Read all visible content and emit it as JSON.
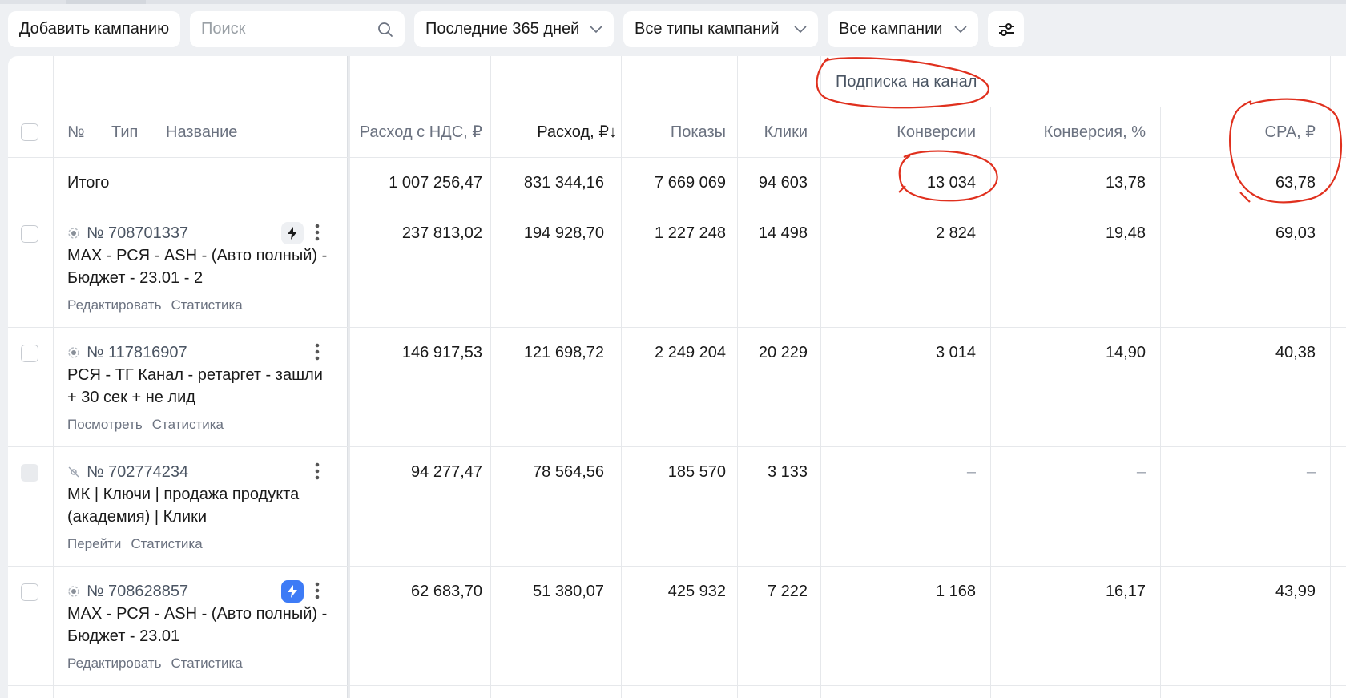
{
  "toolbar": {
    "add_campaign": "Добавить кампанию",
    "search_placeholder": "Поиск",
    "period": "Последние 365 дней",
    "campaign_types": "Все типы кампаний",
    "campaigns": "Все кампании"
  },
  "table": {
    "group_header": "Подписка на канал",
    "headers": {
      "number": "№",
      "type": "Тип",
      "name": "Название",
      "spend_vat": "Расход с НДС, ₽",
      "spend": "Расход, ₽↓",
      "impressions": "Показы",
      "clicks": "Клики",
      "conversions": "Конверсии",
      "conversion_rate": "Конверсия, %",
      "cpa": "CPA, ₽"
    },
    "total": {
      "label": "Итого",
      "spend_vat": "1 007 256,47",
      "spend": "831 344,16",
      "impressions": "7 669 069",
      "clicks": "94 603",
      "conversions": "13 034",
      "conversion_rate": "13,78",
      "cpa": "63,78"
    },
    "rows": [
      {
        "id": "№ 708701337",
        "name": "MAX - РСЯ - ASH - (Авто полный) - Бюджет - 23.01 - 2",
        "link1": "Редактировать",
        "link2": "Статистика",
        "spend_vat": "237 813,02",
        "spend": "194 928,70",
        "impressions": "1 227 248",
        "clicks": "14 498",
        "conversions": "2 824",
        "conversion_rate": "19,48",
        "cpa": "69,03"
      },
      {
        "id": "№ 117816907",
        "name": "РСЯ - ТГ Канал - ретаргет - зашли + 30 сек + не лид",
        "link1": "Посмотреть",
        "link2": "Статистика",
        "spend_vat": "146 917,53",
        "spend": "121 698,72",
        "impressions": "2 249 204",
        "clicks": "20 229",
        "conversions": "3 014",
        "conversion_rate": "14,90",
        "cpa": "40,38"
      },
      {
        "id": "№ 702774234",
        "name": "МК | Ключи | продажа продукта (академия) | Клики",
        "link1": "Перейти",
        "link2": "Статистика",
        "spend_vat": "94 277,47",
        "spend": "78 564,56",
        "impressions": "185 570",
        "clicks": "3 133",
        "conversions": "–",
        "conversion_rate": "–",
        "cpa": "–"
      },
      {
        "id": "№ 708628857",
        "name": "MAX - РСЯ - ASH - (Авто полный) - Бюджет - 23.01",
        "link1": "Редактировать",
        "link2": "Статистика",
        "spend_vat": "62 683,70",
        "spend": "51 380,07",
        "impressions": "425 932",
        "clicks": "7 222",
        "conversions": "1 168",
        "conversion_rate": "16,17",
        "cpa": "43,99"
      }
    ]
  },
  "colors": {
    "annotation": "#e0301e",
    "bolt_active": "#3d7bf6",
    "background": "#eef0f3"
  }
}
